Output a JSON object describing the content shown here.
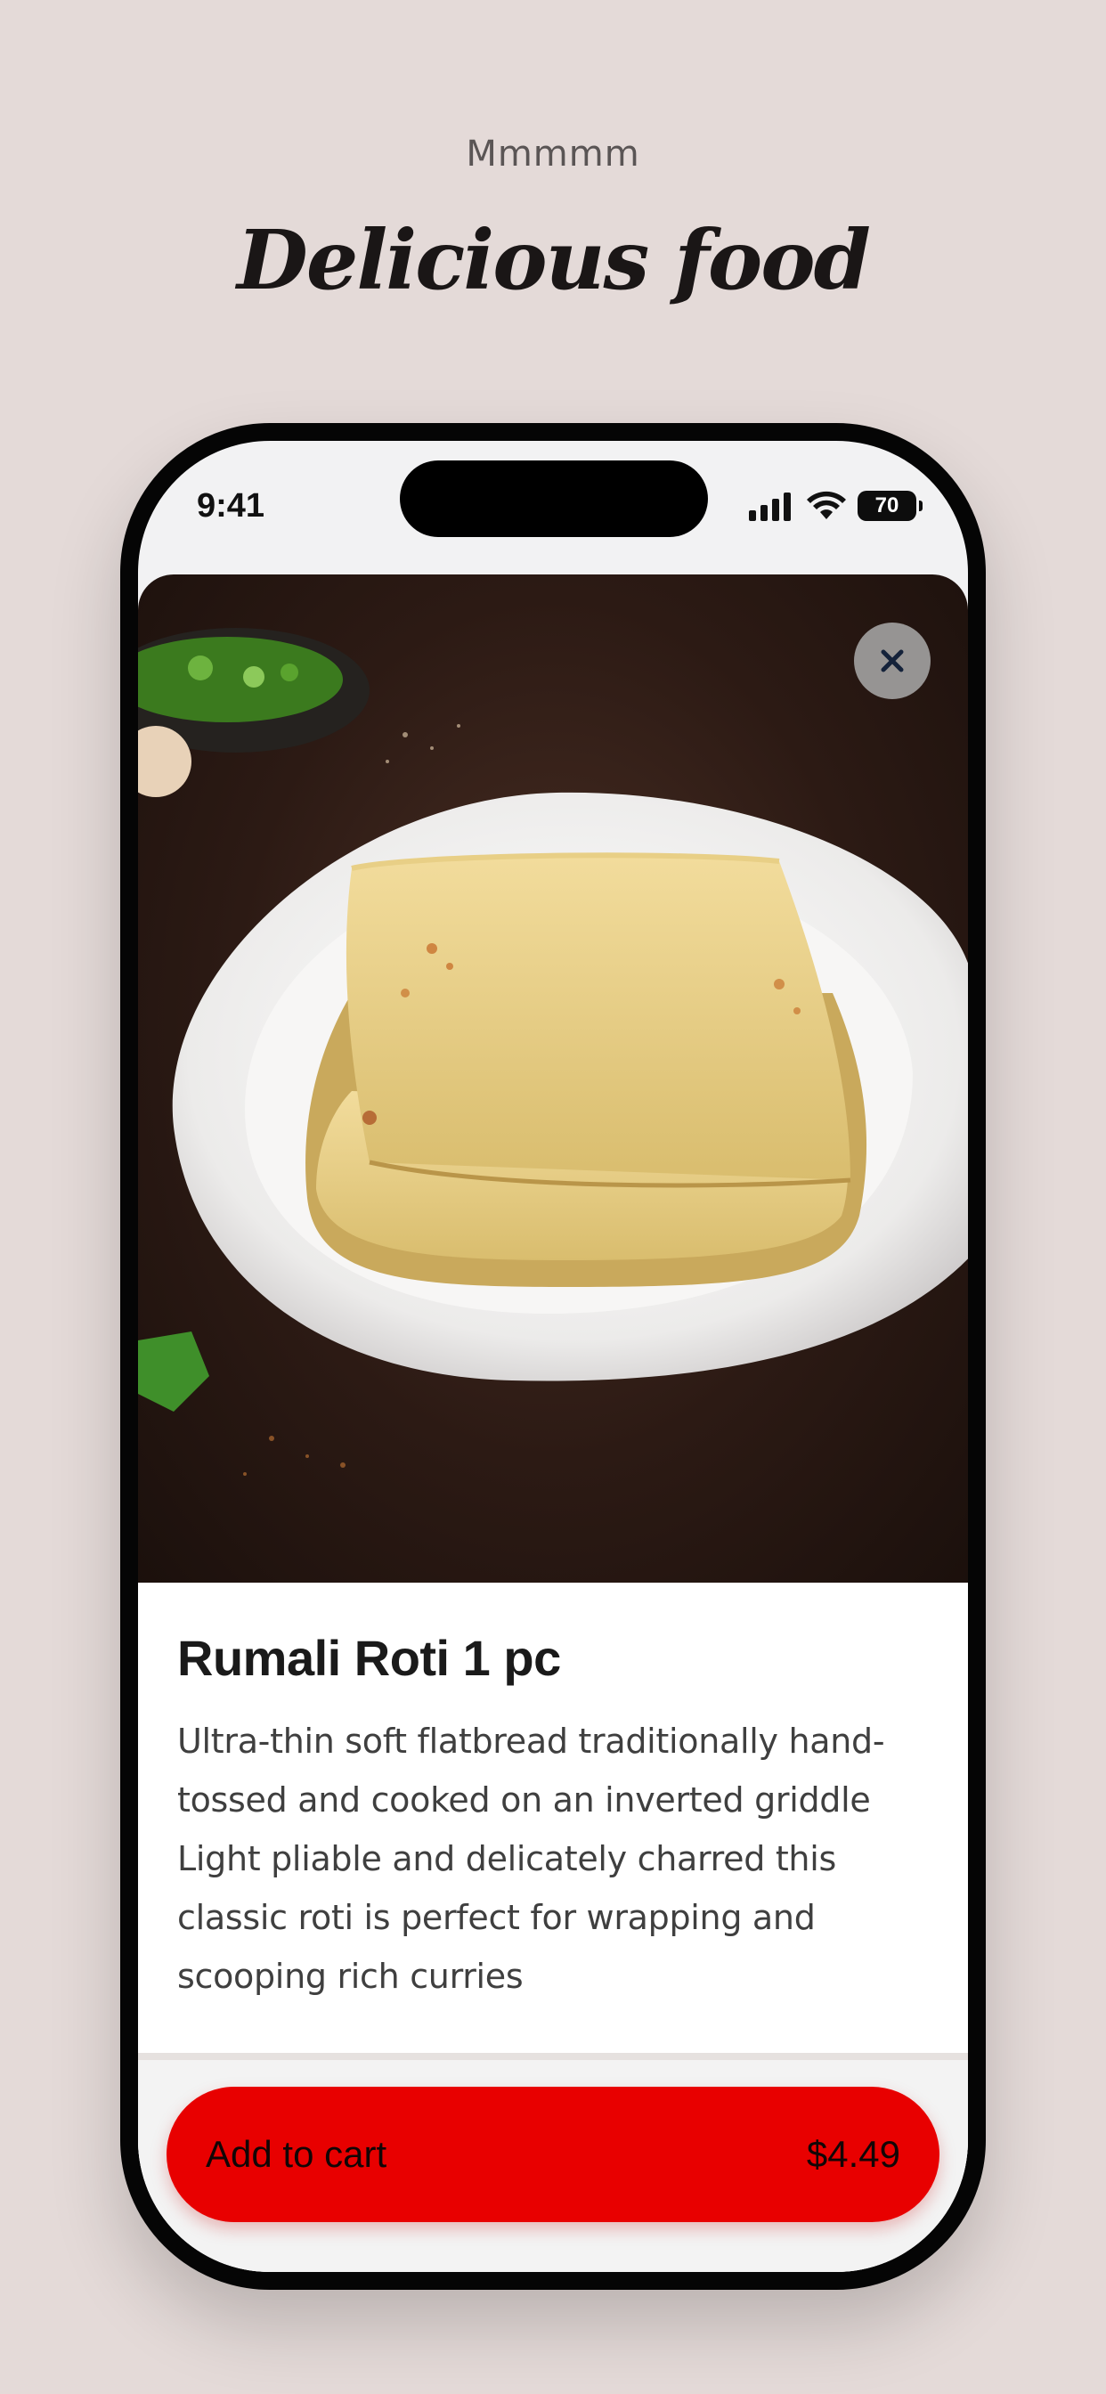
{
  "header": {
    "tagline": "Mmmmm",
    "title": "Delicious food"
  },
  "status_bar": {
    "time": "9:41",
    "battery": "70",
    "icons": [
      "cellular-signal-icon",
      "wifi-icon",
      "battery-icon"
    ]
  },
  "product": {
    "image_alt": "Folded rumali roti on a white plate",
    "title": "Rumali Roti 1 pc",
    "description": "Ultra-thin soft flatbread traditionally hand-tossed and cooked on an inverted griddle Light pliable and delicately charred this classic roti is perfect for wrapping and scooping rich curries"
  },
  "actions": {
    "close_icon": "close-icon",
    "add_to_cart_label": "Add to cart",
    "price": "$4.49"
  },
  "colors": {
    "background": "#e4dad8",
    "accent": "#e80000",
    "frame": "#050505"
  }
}
